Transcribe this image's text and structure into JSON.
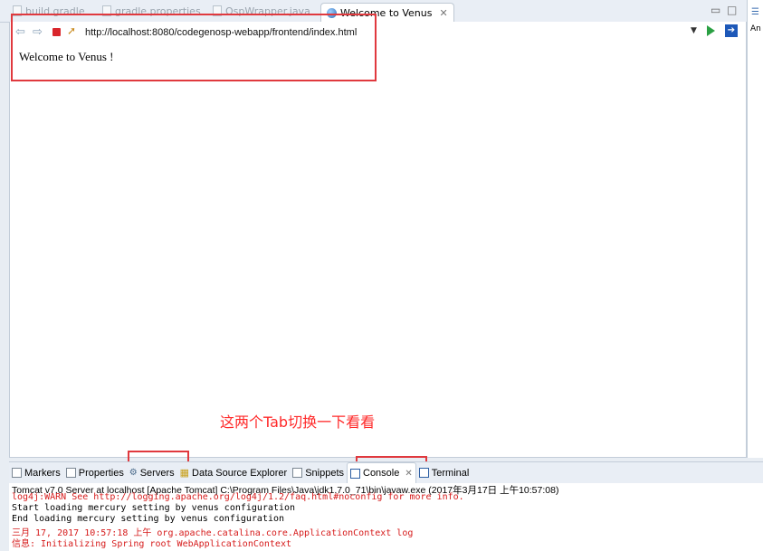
{
  "editor_tabs": [
    {
      "label": "build.gradle"
    },
    {
      "label": "gradle.properties"
    },
    {
      "label": "OspWrapper.java"
    },
    {
      "label": "Welcome to Venus"
    }
  ],
  "browser": {
    "url": "http://localhost:8080/codegenosp-webapp/frontend/index.html",
    "page_text": "Welcome to Venus !"
  },
  "right_panel": {
    "label": "An"
  },
  "annotation": {
    "text": "这两个Tab切换一下看看"
  },
  "bottom_tabs": [
    {
      "label": "Markers"
    },
    {
      "label": "Properties"
    },
    {
      "label": "Servers"
    },
    {
      "label": "Data Source Explorer"
    },
    {
      "label": "Snippets"
    },
    {
      "label": "Console"
    },
    {
      "label": "Terminal"
    }
  ],
  "console": {
    "header": "Tomcat v7.0 Server at localhost [Apache Tomcat] C:\\Program Files\\Java\\jdk1.7.0_71\\bin\\javaw.exe (2017年3月17日 上午10:57:08)",
    "lines": [
      {
        "text": "log4j:WARN See http://logging.apache.org/log4j/1.2/faq.html#noconfig for more info.",
        "color": "red"
      },
      {
        "text": "Start loading mercury setting by venus configuration",
        "color": "black"
      },
      {
        "text": "End loading mercury setting by venus configuration",
        "color": "black"
      },
      {
        "text": "三月 17, 2017 10:57:18 上午 org.apache.catalina.core.ApplicationContext log",
        "color": "red"
      },
      {
        "text": "信息: Initializing Spring root WebApplicationContext",
        "color": "red"
      }
    ]
  },
  "colors": {
    "annotation_red": "#e0393e",
    "console_red": "#d61b1b"
  }
}
